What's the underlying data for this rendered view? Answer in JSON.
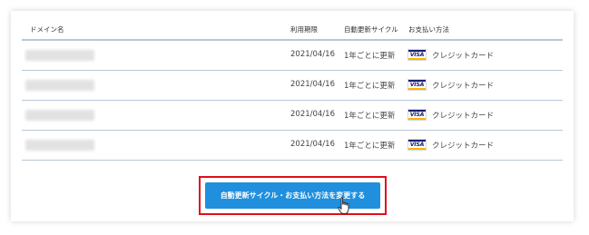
{
  "table": {
    "headers": {
      "domain": "ドメイン名",
      "expiration": "利用期限",
      "renewal_cycle": "自動更新サイクル",
      "payment": "お支払い方法"
    },
    "rows": [
      {
        "domain": "",
        "expiration": "2021/04/16",
        "renewal_cycle": "1年ごとに更新",
        "payment_brand": "VISA",
        "payment_method": "クレジットカード"
      },
      {
        "domain": "",
        "expiration": "2021/04/16",
        "renewal_cycle": "1年ごとに更新",
        "payment_brand": "VISA",
        "payment_method": "クレジットカード"
      },
      {
        "domain": "",
        "expiration": "2021/04/16",
        "renewal_cycle": "1年ごとに更新",
        "payment_brand": "VISA",
        "payment_method": "クレジットカード"
      },
      {
        "domain": "",
        "expiration": "2021/04/16",
        "renewal_cycle": "1年ごとに更新",
        "payment_brand": "VISA",
        "payment_method": "クレジットカード"
      }
    ]
  },
  "change_button": {
    "label": "自動更新サイクル・お支払い方法を変更する"
  },
  "colors": {
    "button": "#1f8fde",
    "highlight_frame": "#e0101a",
    "row_divider": "#b9c8d6"
  },
  "icons": {
    "cursor": "hand-pointer-icon",
    "card": "visa-card-icon"
  }
}
